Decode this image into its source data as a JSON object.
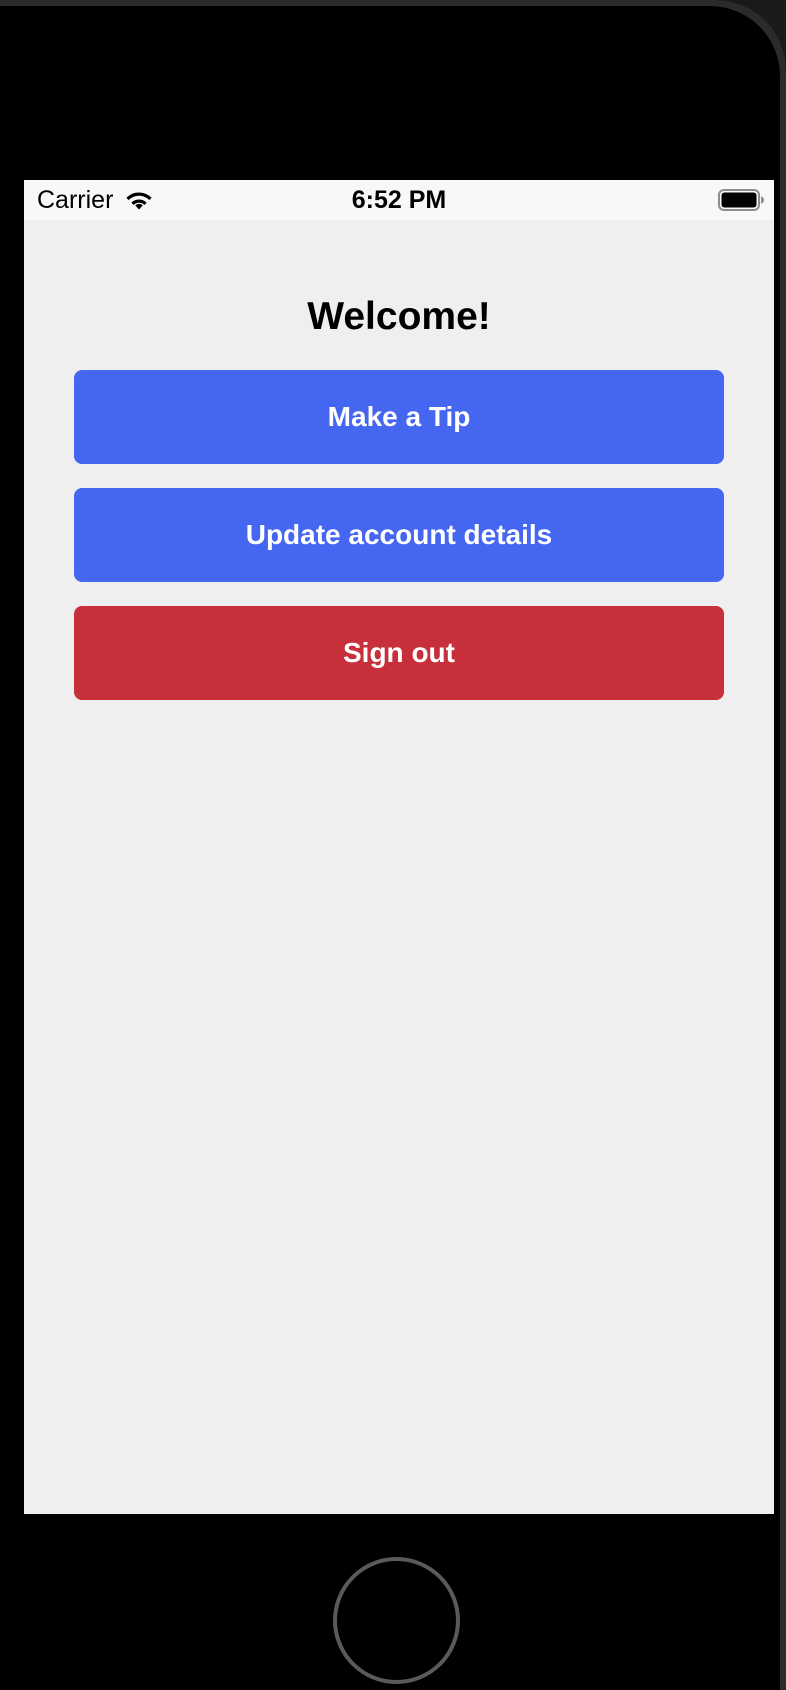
{
  "status_bar": {
    "carrier": "Carrier",
    "time": "6:52 PM",
    "wifi_icon": "wifi-icon",
    "battery_icon": "battery-icon"
  },
  "main": {
    "title": "Welcome!",
    "buttons": {
      "make_tip": "Make a Tip",
      "update_account": "Update account details",
      "sign_out": "Sign out"
    }
  },
  "colors": {
    "primary": "#4566f0",
    "danger": "#c72f3a",
    "background": "#efefef",
    "status_bar": "#f7f8fa"
  },
  "device": {
    "home_button_icon": "home-button"
  }
}
